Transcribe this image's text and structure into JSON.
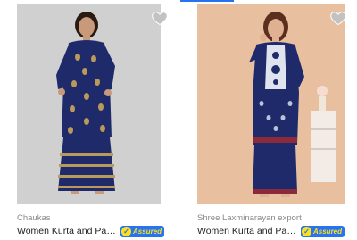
{
  "products": [
    {
      "brand": "Chaukas",
      "title": "Women Kurta and Palaz...",
      "assured_label": "Assured",
      "wishlist_icon": "heart-icon"
    },
    {
      "brand": "Shree Laxminarayan export",
      "title": "Women Kurta and Palaz...",
      "assured_label": "Assured",
      "wishlist_icon": "heart-icon"
    }
  ],
  "colors": {
    "accent": "#2874f0",
    "assured_text": "#ffe11b",
    "brand_text": "#878787",
    "title_text": "#212121"
  }
}
